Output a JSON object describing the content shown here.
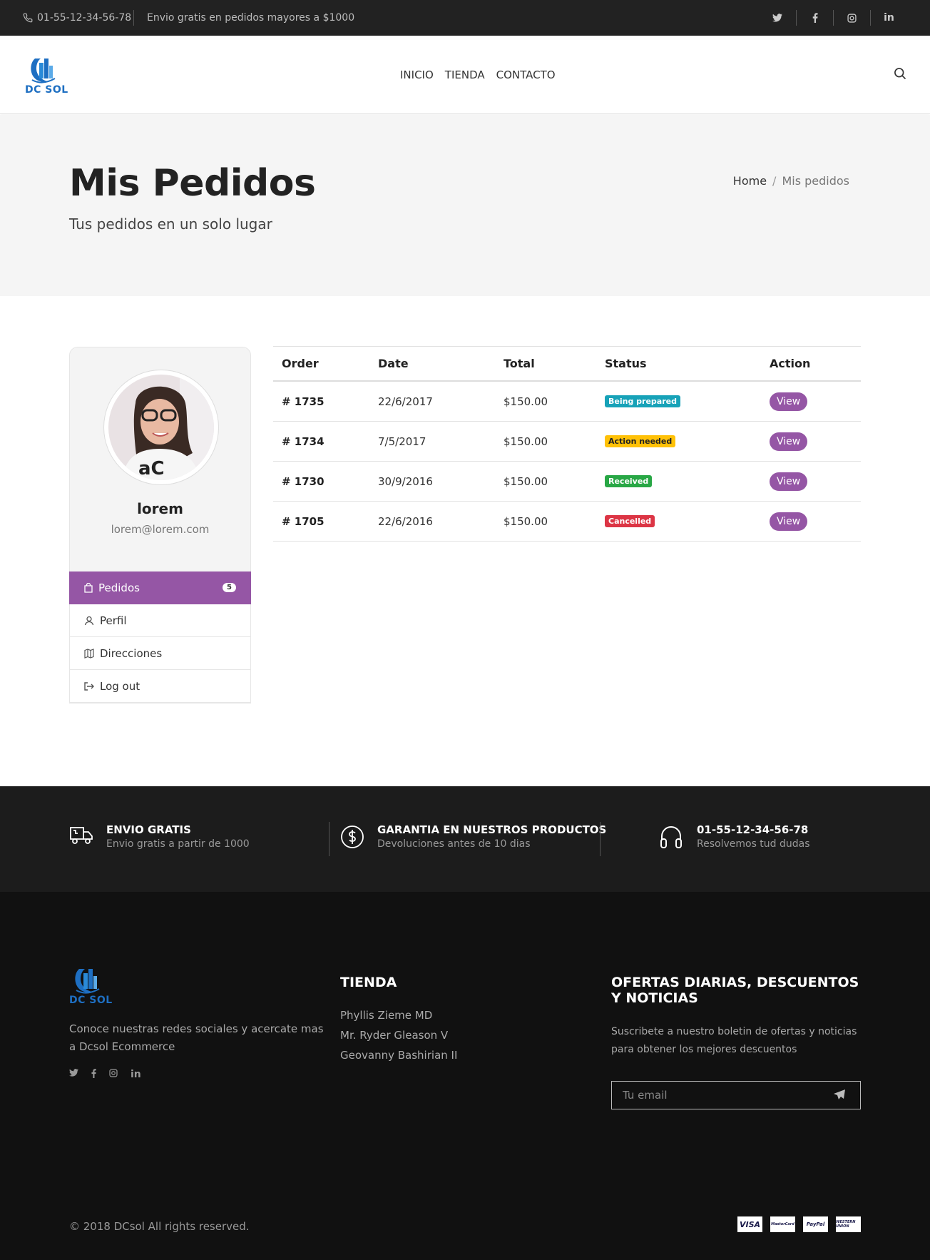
{
  "topbar": {
    "phone": "01-55-12-34-56-78",
    "promo": "Envio gratis en pedidos mayores a $1000",
    "social_icons": [
      "twitter-icon",
      "facebook-icon",
      "instagram-icon",
      "linkedin-icon"
    ]
  },
  "header": {
    "logo_text": "DC SOL",
    "nav": [
      "INICIO",
      "TIENDA",
      "CONTACTO"
    ]
  },
  "banner": {
    "title": "Mis Pedidos",
    "subtitle": "Tus pedidos en un solo lugar",
    "breadcrumb": {
      "home": "Home",
      "separator": "/",
      "current": "Mis pedidos"
    }
  },
  "profile": {
    "name": "lorem",
    "email": "lorem@lorem.com",
    "menu": [
      {
        "label": "Pedidos",
        "badge": "5",
        "icon": "bag-icon",
        "active": true
      },
      {
        "label": "Perfil",
        "icon": "user-icon",
        "active": false
      },
      {
        "label": "Direcciones",
        "icon": "map-icon",
        "active": false
      },
      {
        "label": "Log out",
        "icon": "logout-icon",
        "active": false
      }
    ]
  },
  "orders": {
    "headers": [
      "Order",
      "Date",
      "Total",
      "Status",
      "Action"
    ],
    "rows": [
      {
        "order": "# 1735",
        "date": "22/6/2017",
        "total": "$150.00",
        "status": "Being prepared",
        "status_color": "#17a2b8",
        "status_text_color": "#ffffff",
        "action": "View"
      },
      {
        "order": "# 1734",
        "date": "7/5/2017",
        "total": "$150.00",
        "status": "Action needed",
        "status_color": "#ffc107",
        "status_text_color": "#222222",
        "action": "View"
      },
      {
        "order": "# 1730",
        "date": "30/9/2016",
        "total": "$150.00",
        "status": "Received",
        "status_color": "#28a745",
        "status_text_color": "#ffffff",
        "action": "View"
      },
      {
        "order": "# 1705",
        "date": "22/6/2016",
        "total": "$150.00",
        "status": "Cancelled",
        "status_color": "#dc3545",
        "status_text_color": "#ffffff",
        "action": "View"
      }
    ]
  },
  "features": [
    {
      "title": "ENVIO GRATIS",
      "desc": "Envio gratis a partir de 1000",
      "icon": "truck-icon"
    },
    {
      "title": "GARANTIA EN NUESTROS PRODUCTOS",
      "desc": "Devoluciones antes de 10 dias",
      "icon": "dollar-icon"
    },
    {
      "title": "01-55-12-34-56-78",
      "desc": "Resolvemos tud dudas",
      "icon": "headphones-icon"
    }
  ],
  "footer": {
    "logo_text": "DC SOL",
    "about": "Conoce nuestras redes sociales y acercate mas a Dcsol Ecommerce",
    "store_title": "TIENDA",
    "store_links": [
      "Phyllis Zieme MD",
      "Mr. Ryder Gleason V",
      "Geovanny Bashirian II"
    ],
    "news_title": "OFERTAS DIARIAS, DESCUENTOS Y NOTICIAS",
    "news_text": "Suscribete a nuestro boletin de ofertas y noticias para obtener los mejores descuentos",
    "email_placeholder": "Tu email",
    "copyright": "© 2018 DCsol All rights reserved.",
    "payment_cards": [
      "VISA",
      "MasterCard",
      "PayPal",
      "WESTERN UNION"
    ]
  },
  "colors": {
    "accent": "#9556a5",
    "logo_blue": "#1e6fc2"
  }
}
